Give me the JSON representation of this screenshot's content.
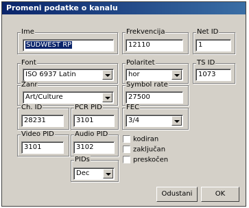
{
  "window": {
    "title": "Promeni podatke o kanalu"
  },
  "fields": {
    "ime": {
      "label": "Ime",
      "value": "SÜDWEST RP"
    },
    "frekvencija": {
      "label": "Frekvencija",
      "value": "12110"
    },
    "net_id": {
      "label": "Net ID",
      "value": "1"
    },
    "font": {
      "label": "Font",
      "value": "ISO 6937 Latin"
    },
    "polaritet": {
      "label": "Polaritet",
      "value": "hor"
    },
    "ts_id": {
      "label": "TS ID",
      "value": "1073"
    },
    "zanr": {
      "label": "Žanr",
      "value": "Art/Culture"
    },
    "symbol_rate": {
      "label": "Symbol rate",
      "value": "27500"
    },
    "ch_id": {
      "label": "Ch. ID",
      "value": "28231"
    },
    "pcr_pid": {
      "label": "PCR PID",
      "value": "3101"
    },
    "fec": {
      "label": "FEC",
      "value": "3/4"
    },
    "video_pid": {
      "label": "Video PID",
      "value": "3101"
    },
    "audio_pid": {
      "label": "Audio PID",
      "value": "3102"
    },
    "pids": {
      "label": "PIDs",
      "value": "Dec"
    }
  },
  "checkboxes": [
    {
      "label": "kodiran",
      "checked": false
    },
    {
      "label": "zaključan",
      "checked": false
    },
    {
      "label": "preskočen",
      "checked": false
    }
  ],
  "buttons": {
    "cancel": "Odustani",
    "ok": "OK"
  }
}
